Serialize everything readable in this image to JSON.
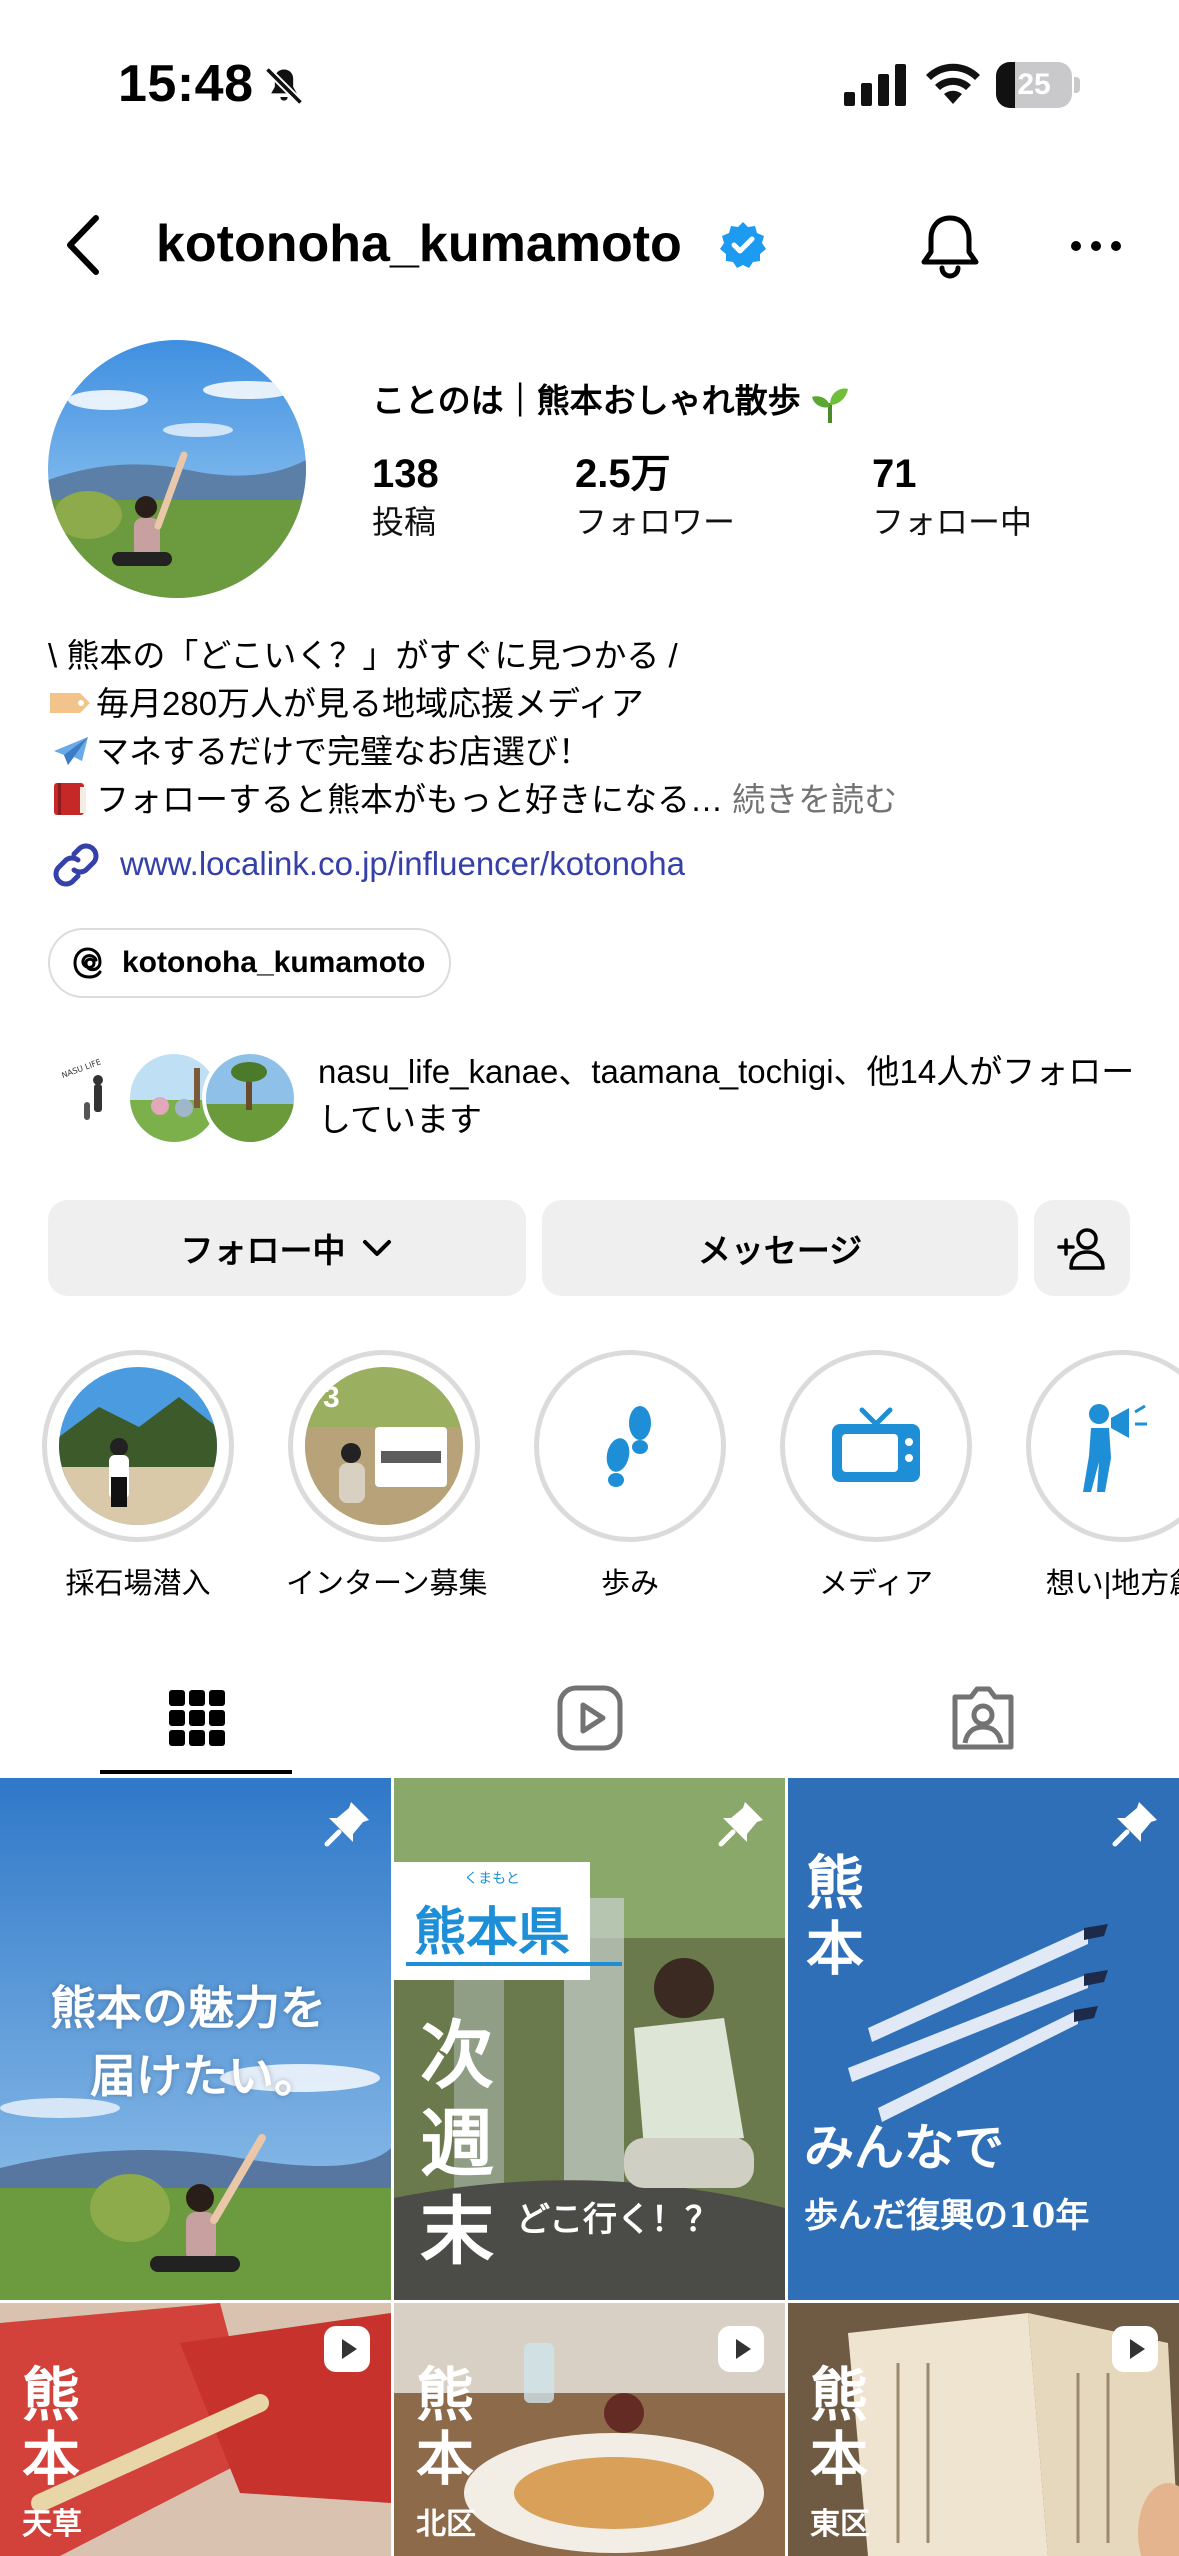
{
  "status_bar": {
    "time": "15:48",
    "battery_level": "25",
    "battery_fraction": 0.25
  },
  "header": {
    "username": "kotonoha_kumamoto"
  },
  "profile": {
    "display_name": "ことのは｜熊本おしゃれ散歩",
    "stats": [
      {
        "value": "138",
        "label": "投稿"
      },
      {
        "value": "2.5万",
        "label": "フォロワー"
      },
      {
        "value": "71",
        "label": "フォロー中"
      }
    ],
    "bio": [
      "\\ 熊本の「どこいく？」がすぐに見つかる /",
      "毎月280万人が見る地域応援メディア",
      "マネするだけで完璧なお店選び！",
      "フォローすると熊本がもっと好きになる… "
    ],
    "bio_more": "続きを読む",
    "bio_emoji_icons": [
      "label-tag-icon",
      "airplane-icon",
      "book-icon"
    ],
    "link": "www.localink.co.jp/influencer/kotonoha",
    "threads_handle": "kotonoha_kumamoto",
    "followed_by": "nasu_life_kanae、taamana_tochigi、他14人がフォローしています",
    "followed_avatar_text": "NASU LIFE"
  },
  "actions": {
    "following": "フォロー中",
    "message": "メッセージ"
  },
  "highlights": [
    {
      "label": "採石場潜入"
    },
    {
      "label": "インターン募集",
      "badge": "3"
    },
    {
      "label": "歩み",
      "icon": "footprints-icon"
    },
    {
      "label": "メディア",
      "icon": "tv-icon"
    },
    {
      "label": "想い|地方創",
      "icon": "megaphone-person-icon"
    }
  ],
  "tabs": [
    "grid-icon",
    "reels-icon",
    "tagged-icon"
  ],
  "posts": [
    {
      "lines": [
        "熊本の魅力を",
        "届けたい。"
      ],
      "type": "pinned"
    },
    {
      "title_tag": "熊本県",
      "ruby": "くまもと",
      "vertical": "次週末",
      "sub": "どこ行く！？",
      "type": "pinned"
    },
    {
      "vertical": "熊本",
      "lines": [
        "みんなで",
        "歩んだ復興の10年"
      ],
      "type": "pinned"
    },
    {
      "vertical": "熊本",
      "sub": "天草",
      "type": "reel"
    },
    {
      "vertical": "熊本",
      "sub": "北区",
      "type": "reel"
    },
    {
      "vertical": "熊本",
      "sub": "東区",
      "type": "reel"
    }
  ],
  "colors": {
    "link": "#3540a8",
    "verified": "#1d9bf0",
    "button_bg": "#efefef",
    "highlight_ring": "#dbdbdb",
    "accent_blue": "#1e8fd6"
  }
}
